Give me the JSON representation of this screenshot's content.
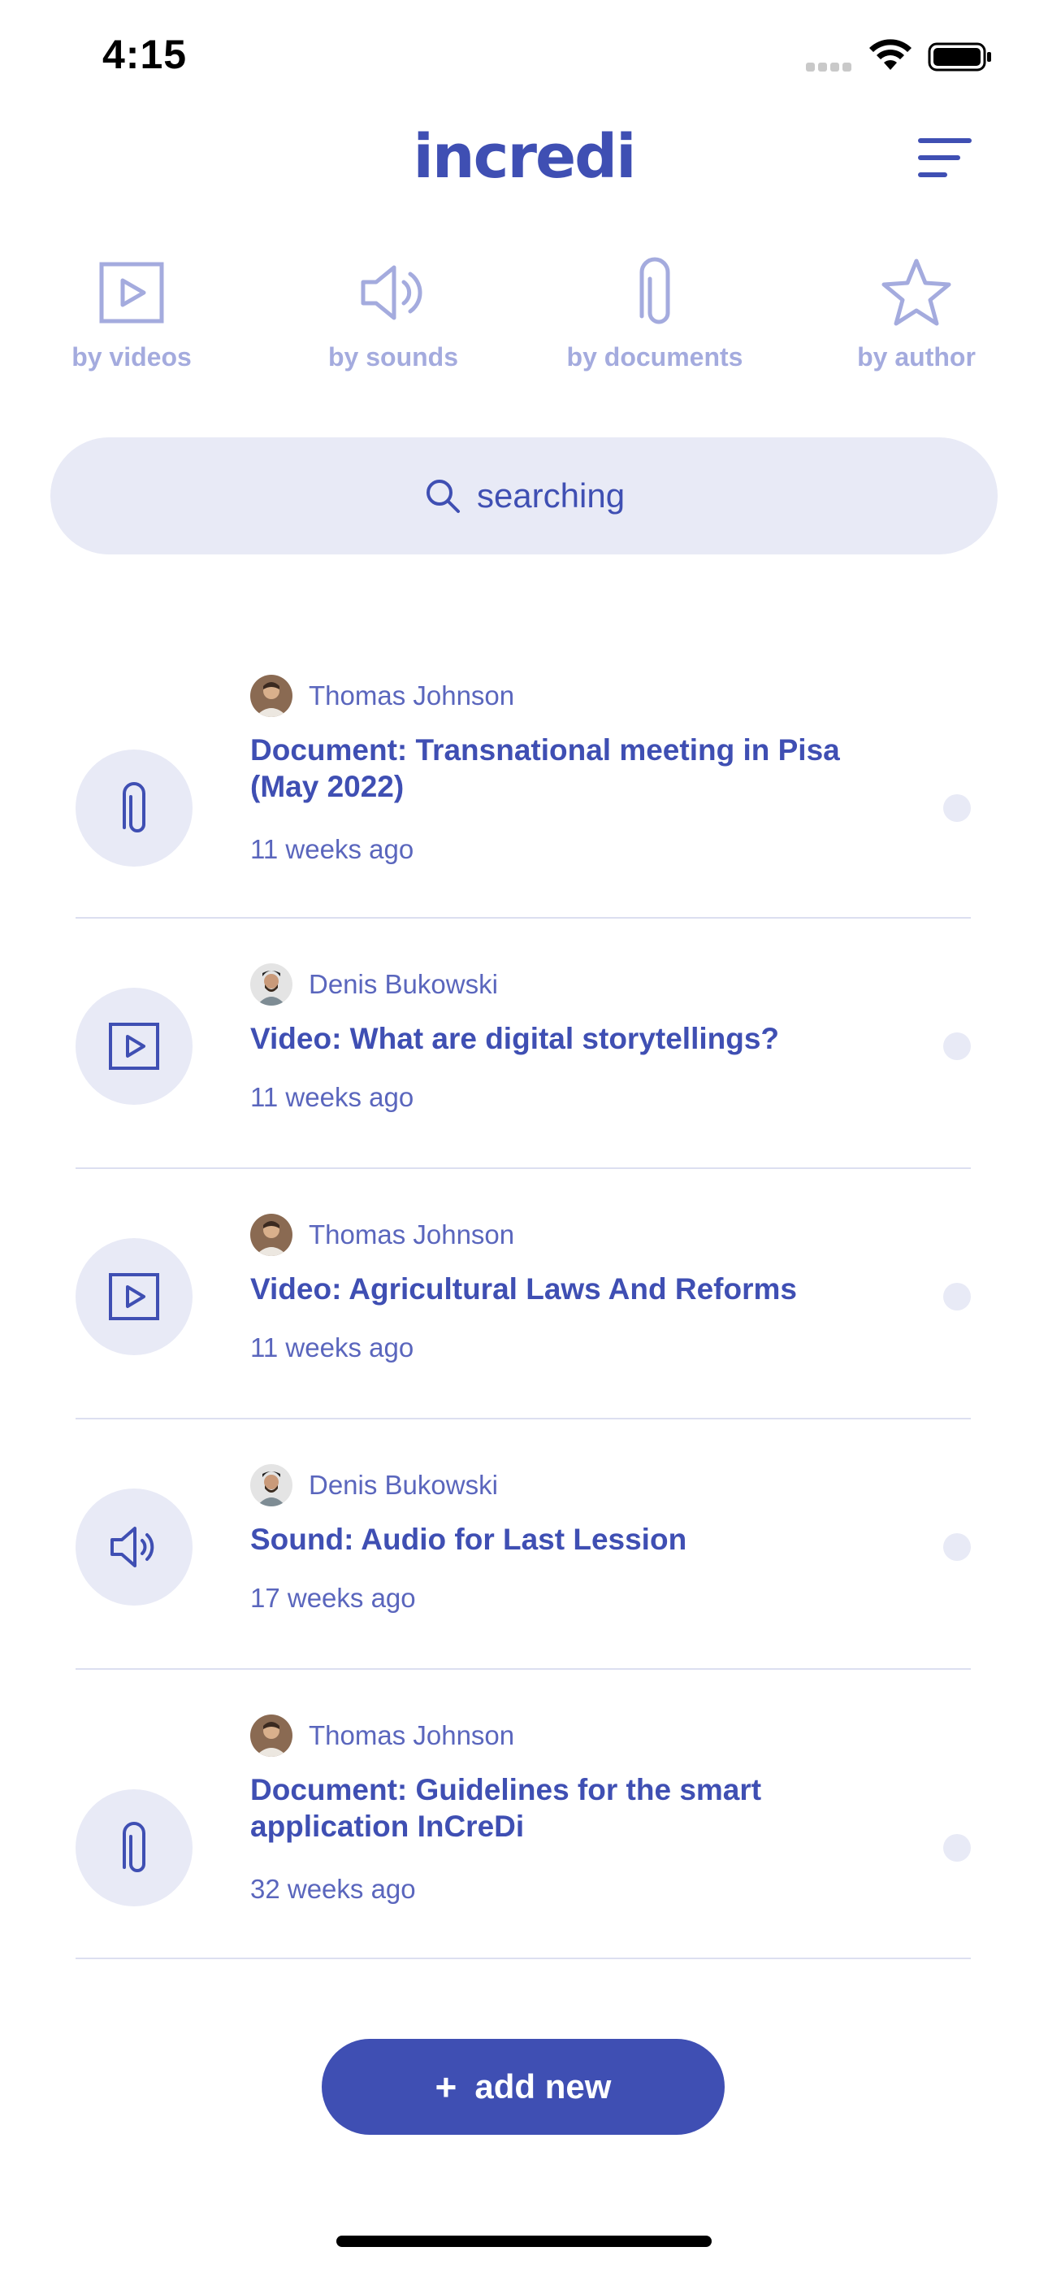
{
  "status_bar": {
    "time": "4:15"
  },
  "header": {
    "logo": "incredi"
  },
  "filters": [
    {
      "label": "by videos",
      "icon": "play-icon"
    },
    {
      "label": "by sounds",
      "icon": "speaker-icon"
    },
    {
      "label": "by documents",
      "icon": "paperclip-icon"
    },
    {
      "label": "by author",
      "icon": "star-icon"
    }
  ],
  "search": {
    "placeholder": "searching"
  },
  "items": [
    {
      "type_icon": "paperclip-icon",
      "author": "Thomas Johnson",
      "title_line1": "Document: Transnational meeting in Pisa",
      "title_line2": "(May 2022)",
      "time": "11 weeks ago"
    },
    {
      "type_icon": "play-icon",
      "author": "Denis  Bukowski",
      "title_line1": "Video: What are digital storytellings?",
      "title_line2": "",
      "time": "11 weeks ago"
    },
    {
      "type_icon": "play-icon",
      "author": "Thomas Johnson",
      "title_line1": "Video: Agricultural Laws And Reforms",
      "title_line2": "",
      "time": "11 weeks ago"
    },
    {
      "type_icon": "speaker-icon",
      "author": "Denis  Bukowski",
      "title_line1": "Sound: Audio for Last Lession",
      "title_line2": "",
      "time": "17 weeks ago"
    },
    {
      "type_icon": "paperclip-icon",
      "author": "Thomas Johnson",
      "title_line1": "Document: Guidelines for the smart",
      "title_line2": "application InCreDi",
      "time": "32 weeks ago"
    }
  ],
  "add_button": {
    "plus": "+",
    "label": "add new"
  },
  "colors": {
    "accent": "#3f4fb3",
    "soft": "#e8eaf6",
    "muted": "#a4abde"
  }
}
